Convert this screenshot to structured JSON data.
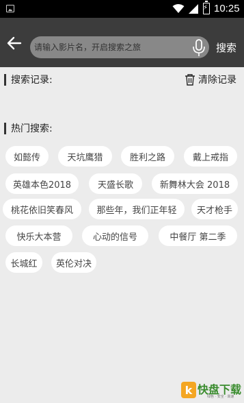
{
  "status_bar": {
    "time": "10:25",
    "icons": [
      "image-icon",
      "wifi-icon",
      "signal-icon",
      "battery-charging-icon"
    ]
  },
  "toolbar": {
    "back_icon": "arrow-left-icon",
    "search_placeholder": "请输入影片名，开启搜索之旅",
    "mic_icon": "microphone-icon",
    "search_label": "搜索"
  },
  "history": {
    "title": "搜索记录:",
    "clear_label": "清除记录",
    "clear_icon": "trash-icon"
  },
  "hot": {
    "title": "热门搜索:",
    "tags": [
      "如懿传",
      "天坑鹰猎",
      "胜利之路",
      "戴上戒指",
      "英雄本色2018",
      "天盛长歌",
      "新舞林大会 2018",
      "桃花依旧笑春风",
      "那些年，我们正年轻",
      "天才枪手",
      "快乐大本营",
      "心动的信号",
      "中餐厅 第二季",
      "长城红",
      "英伦对决"
    ]
  },
  "watermark": {
    "logo_char": "k",
    "name": "快盘下载",
    "slogan": "绿色 · 安全 · 高速"
  },
  "colors": {
    "toolbar_bg": "#3c3c3c",
    "page_bg": "#ececec",
    "tag_bg": "#ffffff"
  }
}
